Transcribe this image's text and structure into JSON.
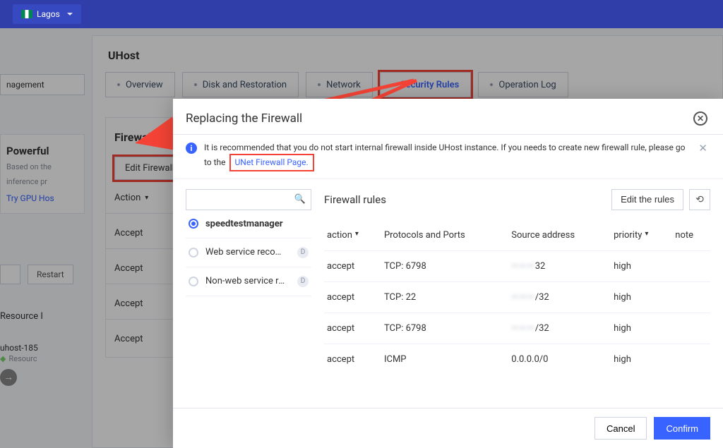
{
  "header": {
    "region": "Lagos"
  },
  "page": {
    "title": "UHost",
    "management_tab": "nagement",
    "tabs": [
      "Overview",
      "Disk and Restoration",
      "Network",
      "Security Rules",
      "Operation Log"
    ],
    "active_tab_index": 3
  },
  "promo": {
    "title": "Powerful",
    "sub1": "Based on the",
    "sub2": "inference pr",
    "link": "Try GPU Hos"
  },
  "bottom_side": {
    "restart_btn": "Restart",
    "resource_label": "Resource I",
    "uhost_id": "uhost-185",
    "uhost_sub": "Resourc"
  },
  "firewall_card": {
    "title": "Firewall",
    "edit_label": "Edit Firewall",
    "action_header": "Action",
    "rows": [
      "Accept",
      "Accept",
      "Accept",
      "Accept"
    ]
  },
  "modal": {
    "title": "Replacing the Firewall",
    "info_text": "It is recommended that you do not start internal firewall inside UHost instance. If you needs to create new firewall rule, please go to the",
    "info_link": "UNet Firewall Page",
    "search_placeholder": "",
    "options": [
      {
        "label": "speedtestmanager",
        "selected": true,
        "default": false
      },
      {
        "label": "Web service recom…",
        "selected": false,
        "default": true
      },
      {
        "label": "Non-web service re…",
        "selected": false,
        "default": true
      }
    ],
    "rules": {
      "title": "Firewall rules",
      "edit_label": "Edit the rules",
      "columns": {
        "action": "action",
        "proto": "Protocols and Ports",
        "source": "Source address",
        "priority": "priority",
        "note": "note"
      },
      "rows": [
        {
          "action": "accept",
          "proto": "TCP: 6798",
          "source_masked": "———",
          "source_suffix": "32",
          "priority": "high"
        },
        {
          "action": "accept",
          "proto": "TCP: 22",
          "source_masked": "———",
          "source_suffix": "/32",
          "priority": "high"
        },
        {
          "action": "accept",
          "proto": "TCP: 6798",
          "source_masked": "———",
          "source_suffix": "/32",
          "priority": "high"
        },
        {
          "action": "accept",
          "proto": "ICMP",
          "source_masked": "",
          "source_suffix": "0.0.0.0/0",
          "priority": "high"
        }
      ]
    },
    "footer": {
      "cancel": "Cancel",
      "confirm": "Confirm"
    }
  }
}
